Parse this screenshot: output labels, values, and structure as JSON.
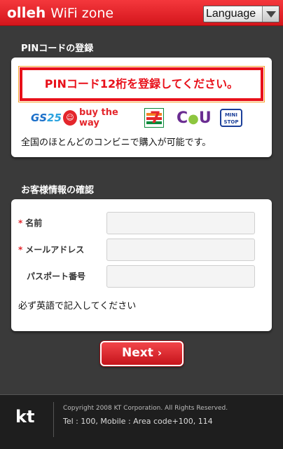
{
  "header": {
    "logo_olleh": "olleh",
    "logo_wifi": "WiFi zone",
    "language_label": "Language"
  },
  "pin_section": {
    "title": "PINコードの登録",
    "instruction": "PINコード12桁を登録してください。",
    "store_logos": {
      "gs25": "GS25",
      "buy_the_way": "buy the way",
      "seven_eleven": "7",
      "cu": "CU",
      "ministop": "MINI STOP"
    },
    "note": "全国のほとんどのコンビニで購入が可能です。"
  },
  "customer_section": {
    "title": "お客様情報の確認",
    "fields": [
      {
        "label": "名前",
        "required": true,
        "value": ""
      },
      {
        "label": "メールアドレス",
        "required": true,
        "value": ""
      },
      {
        "label": "パスポート番号",
        "required": false,
        "value": ""
      }
    ],
    "required_mark": "*",
    "note": "必ず英語で記入してください"
  },
  "next_button": {
    "label": "Next",
    "chevron": "›"
  },
  "footer": {
    "logo": "kt",
    "copyright": "Copyright 2008 KT Corporation. All Rights Reserved.",
    "contact": "Tel : 100, Mobile : Area code+100, 114"
  },
  "colors": {
    "brand_red": "#e4262c",
    "background": "#3a3a3a",
    "footer_bg": "#1e1e1e"
  }
}
